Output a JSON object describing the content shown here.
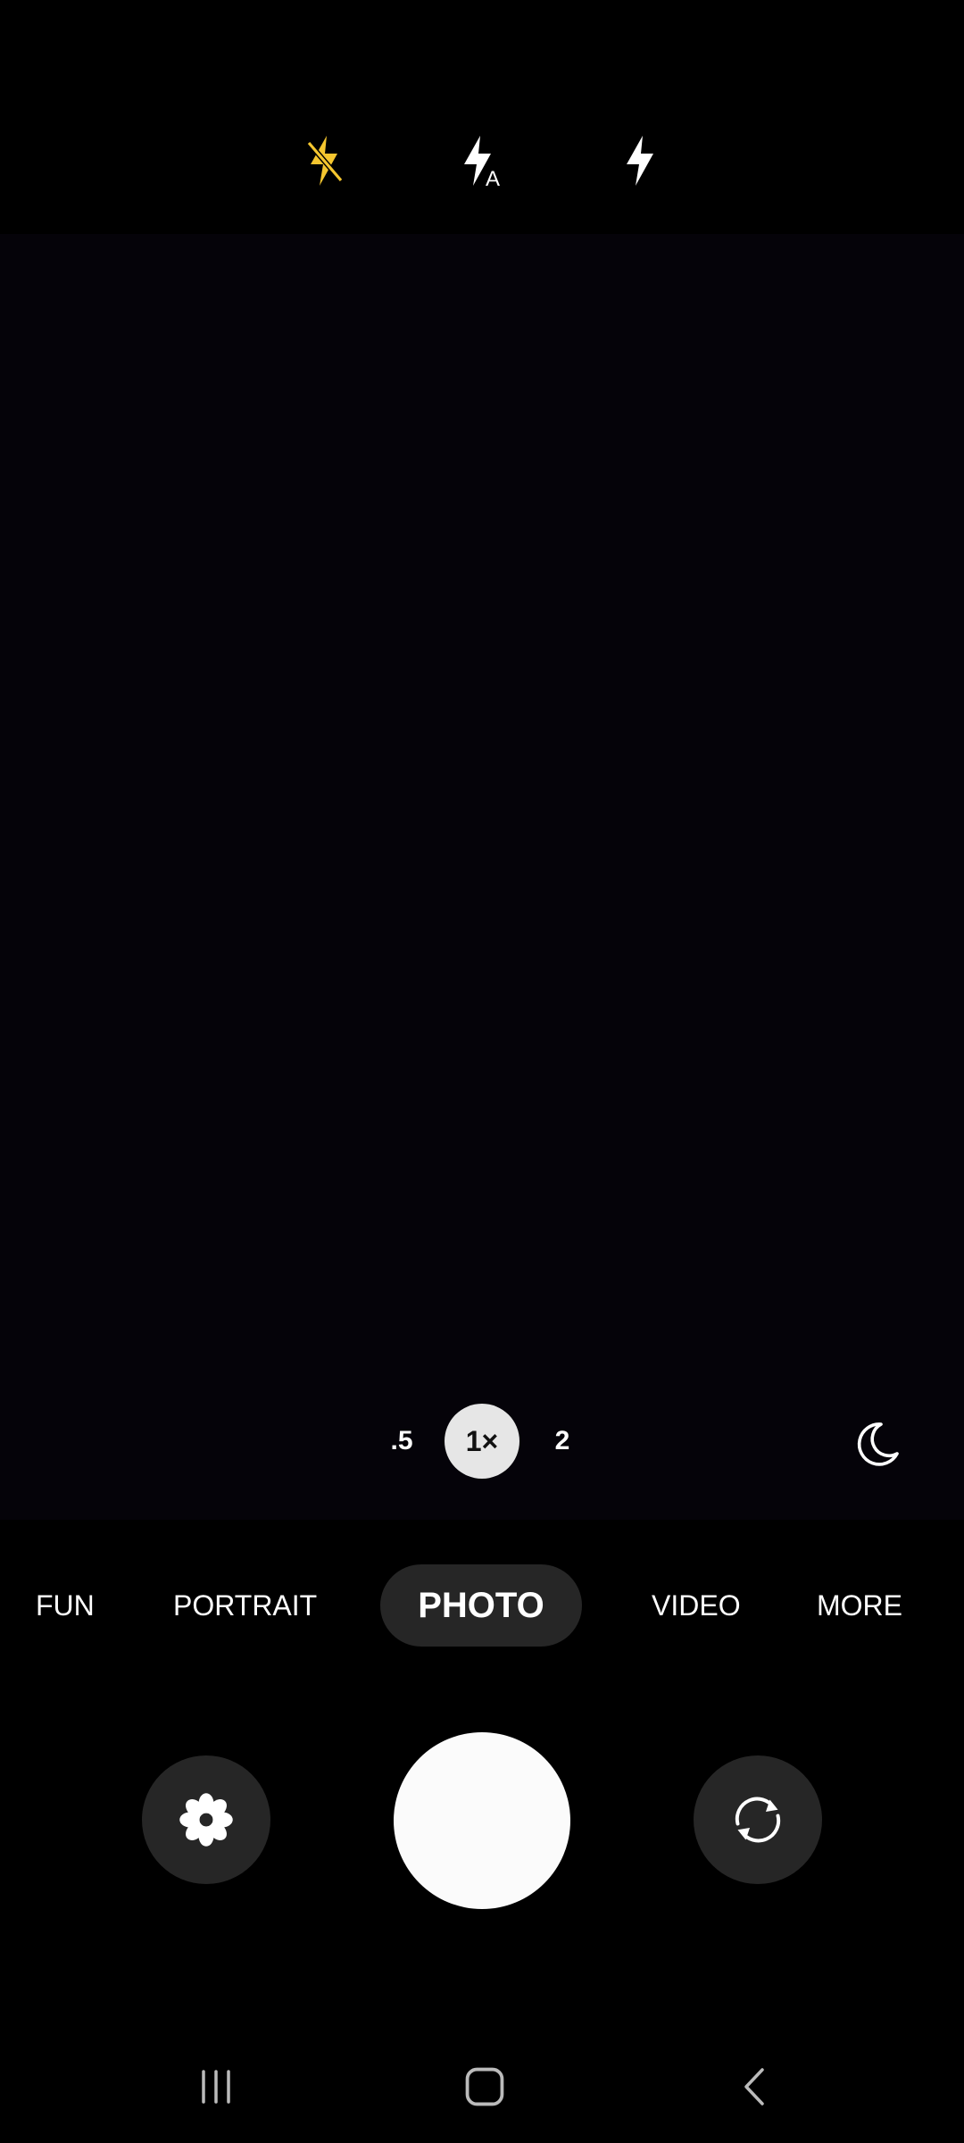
{
  "flash": {
    "options": [
      {
        "id": "off",
        "icon": "flash-off-icon",
        "selected": true
      },
      {
        "id": "auto",
        "icon": "flash-auto-icon",
        "selected": false
      },
      {
        "id": "on",
        "icon": "flash-on-icon",
        "selected": false
      }
    ],
    "selected_color": "#f5c62f"
  },
  "zoom": {
    "options": [
      ".5",
      "1×",
      "2"
    ],
    "selected": "1×"
  },
  "night_mode": {
    "icon": "moon-icon"
  },
  "modes": {
    "items": [
      "FUN",
      "PORTRAIT",
      "PHOTO",
      "VIDEO",
      "MORE"
    ],
    "selected": "PHOTO"
  },
  "controls": {
    "left_icon": "flower-icon",
    "shutter_icon": "shutter-button",
    "right_icon": "switch-camera-icon"
  },
  "navbar": {
    "icons": [
      "recent-apps-icon",
      "home-icon",
      "back-icon"
    ]
  }
}
